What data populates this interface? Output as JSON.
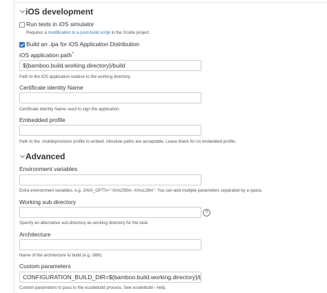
{
  "ios_section": {
    "title": "iOS development",
    "run_tests": {
      "label": "Run tests in iOS simulator",
      "checked": false,
      "requires_prefix": "Requires a ",
      "requires_link": "modification to a post-build script",
      "requires_suffix": " in the Xcode project"
    },
    "build_ipa": {
      "label": "Build an .ipa for iOS Application Distribution",
      "checked": true
    },
    "app_path": {
      "label": "iOS application path",
      "value": "${bamboo.build.working.directory}/build",
      "description": "Path to the iOS application relative to the working directory."
    },
    "cert_identity": {
      "label": "Certificate identity Name",
      "value": "",
      "description": "Certificate Identity Name used to sign the application."
    },
    "embedded_profile": {
      "label": "Embedded profile",
      "value": "",
      "description": "Path to the .mobileprovision profile to embed. Absolute paths are acceptable. Leave blank for no embedded profile."
    }
  },
  "advanced_section": {
    "title": "Advanced",
    "env_vars": {
      "label": "Environment variables",
      "value": "",
      "description": "Extra environment variables. e.g. JAVA_OPTS=\"-Xmx256m -Xms128m\". You can add multiple parameters separated by a space."
    },
    "working_sub_dir": {
      "label": "Working sub directory",
      "value": "",
      "description": "Specify an alternative sub-directory as working directory for the task.",
      "help_glyph": "?"
    },
    "architecture": {
      "label": "Architecture",
      "value": "",
      "description": "Name of the architecture to build (e.g. i386)."
    },
    "custom_params": {
      "label": "Custom parameters",
      "value": "CONFIGURATION_BUILD_DIR=${bamboo.build.working.directory}/build",
      "description": "Custom parameters to pass to the xcodebuild process. See xcodebuild --help."
    }
  }
}
